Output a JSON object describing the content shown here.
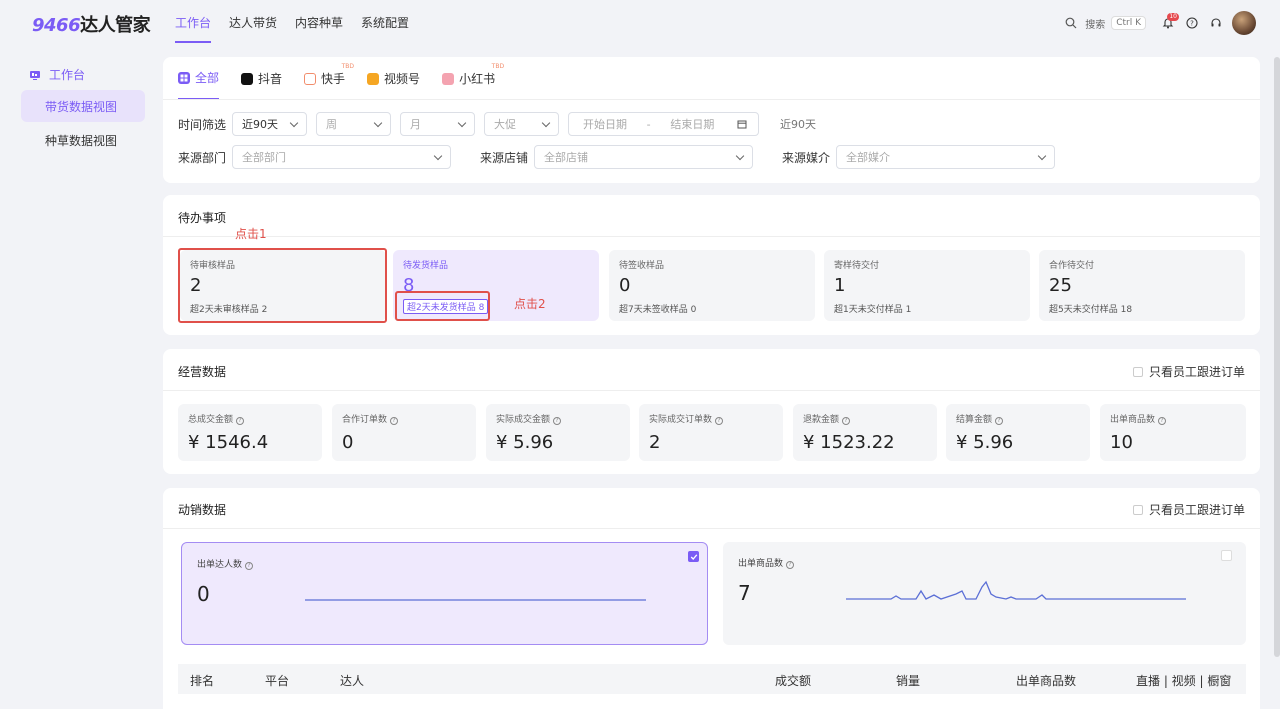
{
  "brand": {
    "num": "9466",
    "name": "达人管家"
  },
  "nav": [
    "工作台",
    "达人带货",
    "内容种草",
    "系统配置"
  ],
  "top": {
    "search": "搜索",
    "shortcut": "Ctrl K",
    "badge": "10"
  },
  "sidebar": {
    "head": "工作台",
    "items": [
      "带货数据视图",
      "种草数据视图"
    ]
  },
  "platform_tabs": [
    {
      "label": "全部",
      "color": "#7b5cf5"
    },
    {
      "label": "抖音",
      "color": "#111111"
    },
    {
      "label": "快手",
      "color": "#f28d6c",
      "sup": "TBD"
    },
    {
      "label": "视频号",
      "color": "#f5a623"
    },
    {
      "label": "小红书",
      "color": "#f4a3b0",
      "sup": "TBD"
    }
  ],
  "filters": {
    "time_label": "时间筛选",
    "time_range": "近90天",
    "week": "周",
    "month": "月",
    "promo": "大促",
    "start": "开始日期",
    "sep": "-",
    "end": "结束日期",
    "summary": "近90天",
    "dept_label": "来源部门",
    "dept": "全部部门",
    "shop_label": "来源店铺",
    "shop": "全部店铺",
    "media_label": "来源媒介",
    "media": "全部媒介"
  },
  "todo": {
    "title": "待办事项",
    "note1": "点击1",
    "note2": "点击2",
    "items": [
      {
        "label": "待审核样品",
        "value": "2",
        "sub": "超2天未审核样品 2"
      },
      {
        "label": "待发货样品",
        "value": "8",
        "sub": "超2天未发货样品 8"
      },
      {
        "label": "待签收样品",
        "value": "0",
        "sub": "超7天未签收样品 0"
      },
      {
        "label": "寄样待交付",
        "value": "1",
        "sub": "超1天未交付样品 1"
      },
      {
        "label": "合作待交付",
        "value": "25",
        "sub": "超5天未交付样品 18"
      }
    ]
  },
  "ops": {
    "title": "经营数据",
    "only_staff": "只看员工跟进订单",
    "metrics": [
      {
        "label": "总成交金额",
        "value": "¥ 1546.4"
      },
      {
        "label": "合作订单数",
        "value": "0"
      },
      {
        "label": "实际成交金额",
        "value": "¥ 5.96"
      },
      {
        "label": "实际成交订单数",
        "value": "2"
      },
      {
        "label": "退款金额",
        "value": "¥ 1523.22"
      },
      {
        "label": "结算金额",
        "value": "¥ 5.96"
      },
      {
        "label": "出单商品数",
        "value": "10"
      }
    ]
  },
  "sales": {
    "title": "动销数据",
    "only_staff": "只看员工跟进订单",
    "cards": [
      {
        "label": "出单达人数",
        "value": "0"
      },
      {
        "label": "出单商品数",
        "value": "7"
      }
    ],
    "columns": [
      "排名",
      "平台",
      "达人",
      "成交额",
      "销量",
      "出单商品数",
      "直播 | 视频 | 橱窗"
    ]
  },
  "colors": {
    "accent": "#7b5cf5",
    "alert": "#e0504a",
    "line": "#5b6fd6"
  }
}
